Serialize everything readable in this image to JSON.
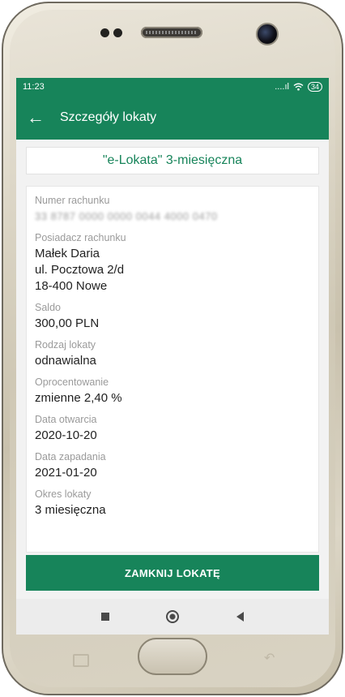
{
  "status_bar": {
    "time": "11:23",
    "signal": "....ıl",
    "battery": "34"
  },
  "app_bar": {
    "title": "Szczegóły lokaty"
  },
  "deposit": {
    "name": "\"e-Lokata\" 3-miesięczna"
  },
  "fields": [
    {
      "label": "Numer rachunku",
      "value": "33 8787 0000 0000 0044 4000 0470",
      "blurred": true
    },
    {
      "label": "Posiadacz rachunku",
      "value_lines": [
        "Małek Daria",
        "ul. Pocztowa 2/d",
        "18-400 Nowe"
      ]
    },
    {
      "label": "Saldo",
      "value": "300,00 PLN"
    },
    {
      "label": "Rodzaj lokaty",
      "value": "odnawialna"
    },
    {
      "label": "Oprocentowanie",
      "value": "zmienne 2,40 %"
    },
    {
      "label": "Data otwarcia",
      "value": "2020-10-20"
    },
    {
      "label": "Data zapadania",
      "value": "2021-01-20"
    },
    {
      "label": "Okres lokaty",
      "value": "3 miesięczna"
    }
  ],
  "actions": {
    "close_deposit": "ZAMKNIJ LOKATĘ"
  },
  "icons": {
    "back": "arrow-left-icon",
    "wifi": "wifi-icon",
    "signal": "signal-icon",
    "battery": "battery-icon"
  },
  "colors": {
    "accent": "#17845a"
  }
}
